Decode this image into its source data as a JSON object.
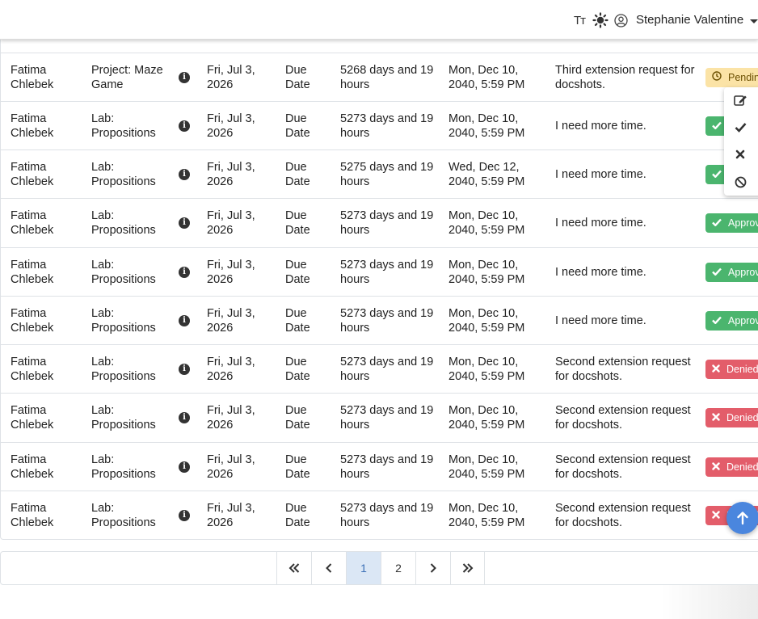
{
  "header": {
    "font_size_icon": "Tт",
    "user_name": "Stephanie Valentine"
  },
  "rows": [
    {
      "student": "Fatima Chlebek",
      "assignment": "Project: Maze Game",
      "due": "Fri, Jul 3, 2026",
      "type": "Due Date",
      "extension": "5268 days and 19 hours",
      "new_date": "Mon, Dec 10, 2040, 5:59 PM",
      "reason": "Third extension request for docshots.",
      "status": "Pending",
      "status_kind": "pending"
    },
    {
      "student": "Fatima Chlebek",
      "assignment": "Lab: Propositions",
      "due": "Fri, Jul 3, 2026",
      "type": "Due Date",
      "extension": "5273 days and 19 hours",
      "new_date": "Mon, Dec 10, 2040, 5:59 PM",
      "reason": "I need more time.",
      "status": "Approved",
      "status_kind": "approved"
    },
    {
      "student": "Fatima Chlebek",
      "assignment": "Lab: Propositions",
      "due": "Fri, Jul 3, 2026",
      "type": "Due Date",
      "extension": "5275 days and 19 hours",
      "new_date": "Wed, Dec 12, 2040, 5:59 PM",
      "reason": "I need more time.",
      "status": "Approved",
      "status_kind": "approved"
    },
    {
      "student": "Fatima Chlebek",
      "assignment": "Lab: Propositions",
      "due": "Fri, Jul 3, 2026",
      "type": "Due Date",
      "extension": "5273 days and 19 hours",
      "new_date": "Mon, Dec 10, 2040, 5:59 PM",
      "reason": "I need more time.",
      "status": "Approved",
      "status_kind": "approved"
    },
    {
      "student": "Fatima Chlebek",
      "assignment": "Lab: Propositions",
      "due": "Fri, Jul 3, 2026",
      "type": "Due Date",
      "extension": "5273 days and 19 hours",
      "new_date": "Mon, Dec 10, 2040, 5:59 PM",
      "reason": "I need more time.",
      "status": "Approved",
      "status_kind": "approved"
    },
    {
      "student": "Fatima Chlebek",
      "assignment": "Lab: Propositions",
      "due": "Fri, Jul 3, 2026",
      "type": "Due Date",
      "extension": "5273 days and 19 hours",
      "new_date": "Mon, Dec 10, 2040, 5:59 PM",
      "reason": "I need more time.",
      "status": "Approved",
      "status_kind": "approved"
    },
    {
      "student": "Fatima Chlebek",
      "assignment": "Lab: Propositions",
      "due": "Fri, Jul 3, 2026",
      "type": "Due Date",
      "extension": "5273 days and 19 hours",
      "new_date": "Mon, Dec 10, 2040, 5:59 PM",
      "reason": "Second extension request for docshots.",
      "status": "Denied",
      "status_kind": "denied"
    },
    {
      "student": "Fatima Chlebek",
      "assignment": "Lab: Propositions",
      "due": "Fri, Jul 3, 2026",
      "type": "Due Date",
      "extension": "5273 days and 19 hours",
      "new_date": "Mon, Dec 10, 2040, 5:59 PM",
      "reason": "Second extension request for docshots.",
      "status": "Denied",
      "status_kind": "denied"
    },
    {
      "student": "Fatima Chlebek",
      "assignment": "Lab: Propositions",
      "due": "Fri, Jul 3, 2026",
      "type": "Due Date",
      "extension": "5273 days and 19 hours",
      "new_date": "Mon, Dec 10, 2040, 5:59 PM",
      "reason": "Second extension request for docshots.",
      "status": "Denied",
      "status_kind": "denied"
    },
    {
      "student": "Fatima Chlebek",
      "assignment": "Lab: Propositions",
      "due": "Fri, Jul 3, 2026",
      "type": "Due Date",
      "extension": "5273 days and 19 hours",
      "new_date": "Mon, Dec 10, 2040, 5:59 PM",
      "reason": "Second extension request for docshots.",
      "status": "Denied",
      "status_kind": "denied"
    }
  ],
  "action_menu": {
    "items": [
      "edit-icon",
      "check-icon",
      "times-icon",
      "ban-icon"
    ]
  },
  "pagination": {
    "first": "«",
    "prev": "‹",
    "pages": [
      "1",
      "2"
    ],
    "current": "1",
    "next": "›",
    "last": "»"
  },
  "colors": {
    "pending_bg": "#fbe3a6",
    "approved_bg": "#4bb56e",
    "denied_bg": "#e35d6a",
    "active_page_bg": "#dbe7f5",
    "scroll_top_btn": "#4a86de"
  }
}
